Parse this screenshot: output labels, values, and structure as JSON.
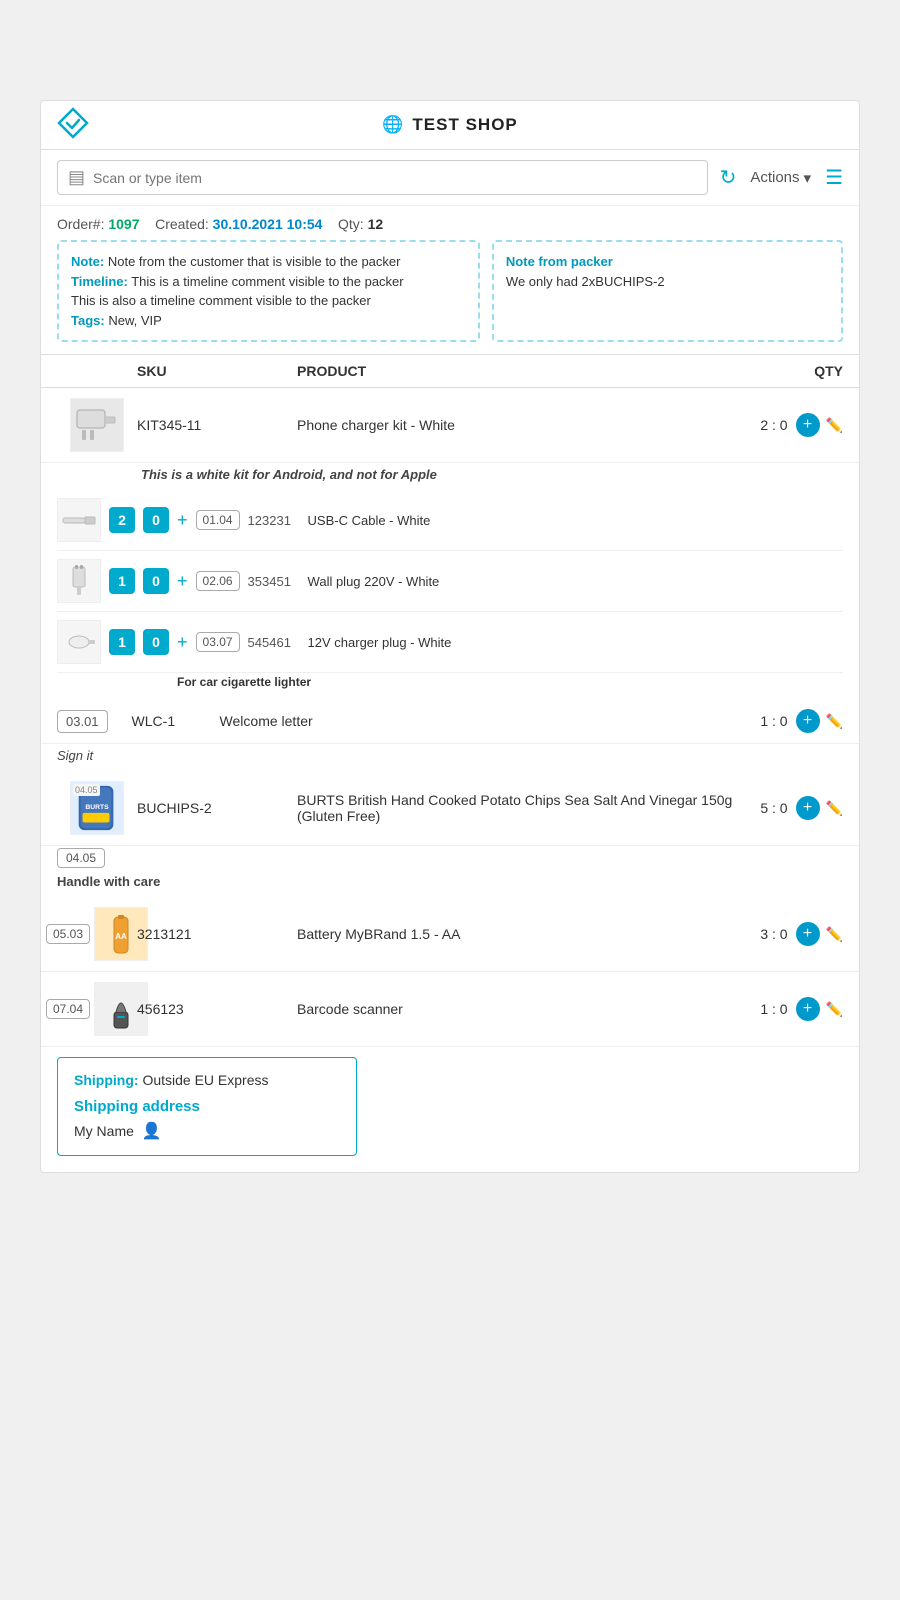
{
  "header": {
    "title": "TEST SHOP",
    "logo_alt": "app-logo"
  },
  "toolbar": {
    "scan_placeholder": "Scan or type item",
    "actions_label": "Actions",
    "actions_arrow": "▾"
  },
  "order": {
    "number_label": "Order#:",
    "number_value": "1097",
    "created_label": "Created:",
    "created_value": "30.10.2021 10:54",
    "qty_label": "Qty:",
    "qty_value": "12"
  },
  "note_left": {
    "note_label": "Note:",
    "note_text": "Note from the customer that is visible to the packer",
    "timeline_label": "Timeline:",
    "timeline_text": "This is a timeline comment visible to the packer",
    "timeline_text2": "This is also a timeline comment visible to the packer",
    "tags_label": "Tags:",
    "tags_value": "New, VIP"
  },
  "note_right": {
    "label": "Note from packer",
    "text": "We only had 2xBUCHIPS-2"
  },
  "table": {
    "col_sku": "SKU",
    "col_product": "PRODUCT",
    "col_qty": "QTY"
  },
  "products": [
    {
      "step": "",
      "sku": "KIT345-11",
      "name": "Phone charger kit - White",
      "qty": "2 : 0",
      "has_image": true,
      "image_label": "kit",
      "sub_note": "This is a white kit for Android, and not for Apple",
      "kit_items": [
        {
          "qty_ordered": "2",
          "qty_scanned": "0",
          "step": "01.04",
          "sku": "123231",
          "name": "USB-C Cable - White",
          "sub_note": ""
        },
        {
          "qty_ordered": "1",
          "qty_scanned": "0",
          "step": "02.06",
          "sku": "353451",
          "name": "Wall plug 220V - White",
          "sub_note": ""
        },
        {
          "qty_ordered": "1",
          "qty_scanned": "0",
          "step": "03.07",
          "sku": "545461",
          "name": "12V charger plug - White",
          "sub_note": "For car cigarette lighter"
        }
      ]
    },
    {
      "step": "03.01",
      "sku": "WLC-1",
      "name": "Welcome letter",
      "qty": "1 : 0",
      "has_image": false,
      "sub_note": "Sign it",
      "kit_items": []
    },
    {
      "step": "04.05",
      "sku": "BUCHIPS-2",
      "name": "BURTS British Hand Cooked Potato Chips Sea Salt And Vinegar 150g (Gluten Free)",
      "qty": "5 : 0",
      "has_image": true,
      "image_label": "chips",
      "sub_note": "Handle with care",
      "kit_items": []
    },
    {
      "step": "05.03",
      "sku": "3213121",
      "name": "Battery MyBRand 1.5 - AA",
      "qty": "3 : 0",
      "has_image": true,
      "image_label": "battery",
      "sub_note": "",
      "kit_items": []
    },
    {
      "step": "07.04",
      "sku": "456123",
      "name": "Barcode scanner",
      "qty": "1 : 0",
      "has_image": true,
      "image_label": "scanner",
      "sub_note": "",
      "kit_items": []
    }
  ],
  "shipping": {
    "label": "Shipping:",
    "value": "Outside EU Express",
    "address_label": "Shipping address",
    "name": "My Name",
    "icon": "👤"
  }
}
